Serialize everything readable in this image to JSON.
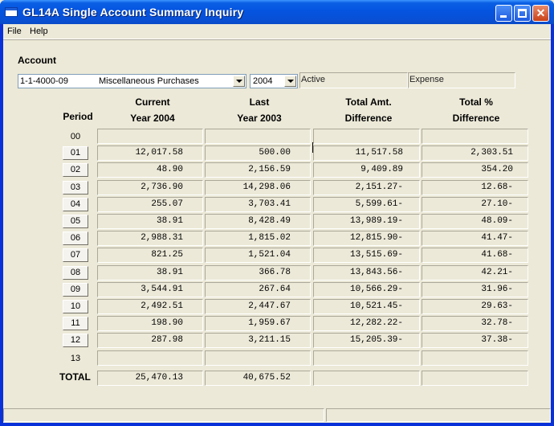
{
  "window": {
    "title": "GL14A  Single Account Summary Inquiry"
  },
  "menu": {
    "file": "File",
    "help": "Help"
  },
  "account": {
    "label": "Account",
    "number": "1-1-4000-09",
    "description": "Miscellaneous Purchases",
    "year": "2004",
    "status": "Active",
    "type": "Expense"
  },
  "headers": {
    "period": "Period",
    "current_1": "Current",
    "current_2": "Year 2004",
    "last_1": "Last",
    "last_2": "Year 2003",
    "amt_1": "Total Amt.",
    "amt_2": "Difference",
    "pct_1": "Total %",
    "pct_2": "Difference"
  },
  "rows": [
    {
      "period": "00",
      "button": false,
      "current": "",
      "last": "",
      "amt": "",
      "pct": ""
    },
    {
      "period": "01",
      "button": true,
      "current": "12,017.58",
      "last": "500.00",
      "amt": "11,517.58",
      "pct": "2,303.51"
    },
    {
      "period": "02",
      "button": true,
      "current": "48.90",
      "last": "2,156.59",
      "amt": "9,409.89",
      "pct": "354.20"
    },
    {
      "period": "03",
      "button": true,
      "current": "2,736.90",
      "last": "14,298.06",
      "amt": "2,151.27-",
      "pct": "12.68-"
    },
    {
      "period": "04",
      "button": true,
      "current": "255.07",
      "last": "3,703.41",
      "amt": "5,599.61-",
      "pct": "27.10-"
    },
    {
      "period": "05",
      "button": true,
      "current": "38.91",
      "last": "8,428.49",
      "amt": "13,989.19-",
      "pct": "48.09-"
    },
    {
      "period": "06",
      "button": true,
      "current": "2,988.31",
      "last": "1,815.02",
      "amt": "12,815.90-",
      "pct": "41.47-"
    },
    {
      "period": "07",
      "button": true,
      "current": "821.25",
      "last": "1,521.04",
      "amt": "13,515.69-",
      "pct": "41.68-"
    },
    {
      "period": "08",
      "button": true,
      "current": "38.91",
      "last": "366.78",
      "amt": "13,843.56-",
      "pct": "42.21-"
    },
    {
      "period": "09",
      "button": true,
      "current": "3,544.91",
      "last": "267.64",
      "amt": "10,566.29-",
      "pct": "31.96-"
    },
    {
      "period": "10",
      "button": true,
      "current": "2,492.51",
      "last": "2,447.67",
      "amt": "10,521.45-",
      "pct": "29.63-"
    },
    {
      "period": "11",
      "button": true,
      "current": "198.90",
      "last": "1,959.67",
      "amt": "12,282.22-",
      "pct": "32.78-"
    },
    {
      "period": "12",
      "button": true,
      "current": "287.98",
      "last": "3,211.15",
      "amt": "15,205.39-",
      "pct": "37.38-"
    },
    {
      "period": "13",
      "button": false,
      "current": "",
      "last": "",
      "amt": "",
      "pct": ""
    }
  ],
  "total": {
    "label": "TOTAL",
    "current": "25,470.13",
    "last": "40,675.52",
    "amt": "",
    "pct": ""
  }
}
